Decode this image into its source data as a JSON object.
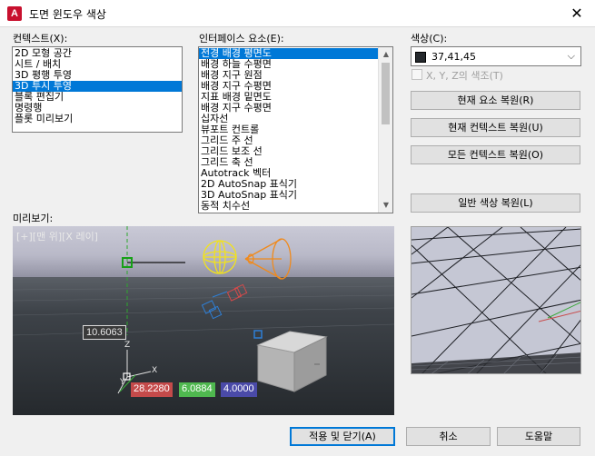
{
  "window": {
    "title": "도면 윈도우 색상",
    "app_icon_letter": "A",
    "close_glyph": "✕"
  },
  "context": {
    "label": "컨텍스트(X):",
    "items": [
      "2D 모형 공간",
      "시트 / 배치",
      "3D 평행 투영",
      "3D 투시 투영",
      "블록 편집기",
      "명령행",
      "플롯 미리보기"
    ],
    "selected_index": 3
  },
  "elements": {
    "label": "인터페이스 요소(E):",
    "items": [
      "전경 배경 평면도",
      "배경 하늘 수평면",
      "배경 지구 원점",
      "배경 지구 수평면",
      "지표 배경 밑면도",
      "배경 지구 수평면",
      "십자선",
      "뷰포트 컨트롤",
      "그리드 주 선",
      "그리드 보조 선",
      "그리드 축 선",
      "Autotrack 벡터",
      "2D AutoSnap 표식기",
      "3D AutoSnap 표식기",
      "동적 치수선"
    ],
    "selected_index": 0
  },
  "color": {
    "label": "색상(C):",
    "value": "37,41,45",
    "swatch_hex": "#25292d",
    "tint_label": "X, Y, Z의 색조(T)",
    "tint_checked": false
  },
  "side_buttons": {
    "restore_element": "현재 요소 복원(R)",
    "restore_context": "현재 컨텍스트 복원(U)",
    "restore_all_contexts": "모든 컨텍스트 복원(O)",
    "restore_classic": "일반 색상 복원(L)"
  },
  "preview": {
    "label": "미리보기:",
    "viewport_label": "[+][맨 위][X 레이]",
    "dim_value": "10.6063",
    "coord_x": "28.2280",
    "coord_y": "6.0884",
    "coord_z": "4.0000",
    "coord_x_color": "#c44a4a",
    "coord_y_color": "#4fb84f",
    "coord_z_color": "#4a4aa8",
    "axis_x_label": "X",
    "axis_y_label": "Y",
    "axis_z_label": "Z"
  },
  "footer": {
    "apply_close": "적용 및 닫기(A)",
    "cancel": "취소",
    "help": "도움말"
  }
}
